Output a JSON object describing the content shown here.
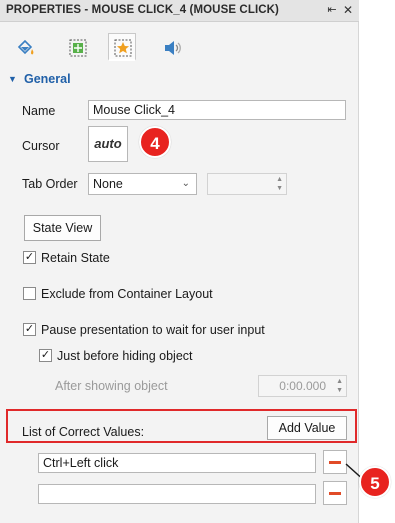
{
  "window": {
    "title": "PROPERTIES - MOUSE CLICK_4 (MOUSE CLICK)"
  },
  "tabs": [
    {
      "name": "fill-icon",
      "active": false
    },
    {
      "name": "size-position-icon",
      "active": false
    },
    {
      "name": "interaction-icon",
      "active": true
    },
    {
      "name": "audio-icon",
      "active": false
    }
  ],
  "section": {
    "title": "General"
  },
  "fields": {
    "name_label": "Name",
    "name_value": "Mouse Click_4",
    "cursor_label": "Cursor",
    "cursor_value": "auto",
    "tab_order_label": "Tab Order",
    "tab_order_value": "None"
  },
  "buttons": {
    "state_view": "State View",
    "add_value": "Add Value"
  },
  "checkboxes": {
    "retain_state": {
      "label": "Retain State",
      "checked": true
    },
    "exclude_layout": {
      "label": "Exclude from Container Layout",
      "checked": false
    },
    "pause_presentation": {
      "label": "Pause presentation to wait for user input",
      "checked": true
    },
    "before_hiding": {
      "label": "Just before hiding object",
      "checked": true
    }
  },
  "after_showing": {
    "label": "After showing object",
    "value": "0:00.000"
  },
  "correct_values": {
    "label": "List of Correct Values:",
    "items": [
      "Ctrl+Left click",
      ""
    ]
  },
  "callouts": {
    "first": "4",
    "second": "5"
  },
  "colors": {
    "accent": "#2060a8",
    "callout": "#e8231f",
    "highlight_frame": "#e0292a",
    "delete": "#e14b28"
  }
}
